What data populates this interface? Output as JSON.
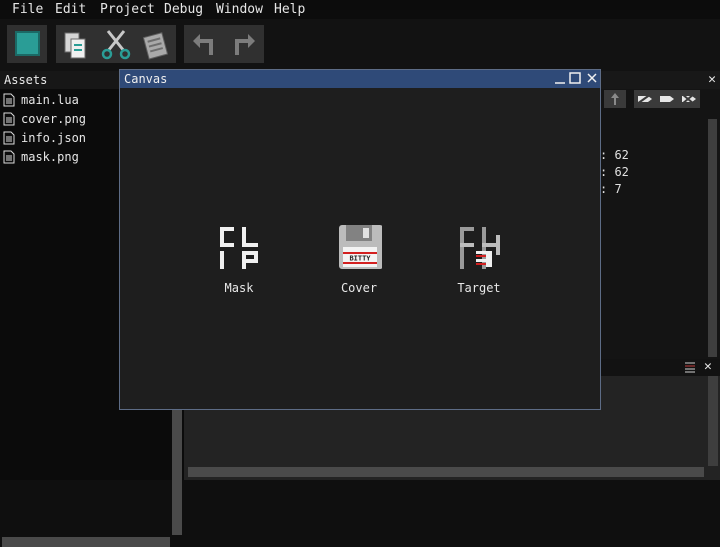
{
  "menu": [
    "File",
    "Edit",
    "Project",
    "Debug",
    "Window",
    "Help"
  ],
  "toolbar": {
    "buttons": [
      "color-swatch",
      "copy",
      "cut",
      "paste",
      "undo",
      "redo"
    ],
    "swatch_color": "#2a9d96"
  },
  "assets": {
    "title": "Assets",
    "files": [
      "main.lua",
      "cover.png",
      "info.json",
      "mask.png"
    ]
  },
  "right_panel": {
    "lines": [
      ": 62",
      ": 62",
      ": 7"
    ]
  },
  "canvas_window": {
    "title": "Canvas",
    "items": [
      {
        "label": "Mask",
        "icon": "clip-icon"
      },
      {
        "label": "Cover",
        "icon": "floppy-icon",
        "badge": "BITTY"
      },
      {
        "label": "Target",
        "icon": "target-icon"
      }
    ]
  },
  "colors": {
    "title_bar": "#2f4a78",
    "window_bg": "#1e1e1e",
    "app_bg": "#0f0f0f",
    "accent_teal": "#2a9d96",
    "badge_red": "#d31f1f"
  }
}
